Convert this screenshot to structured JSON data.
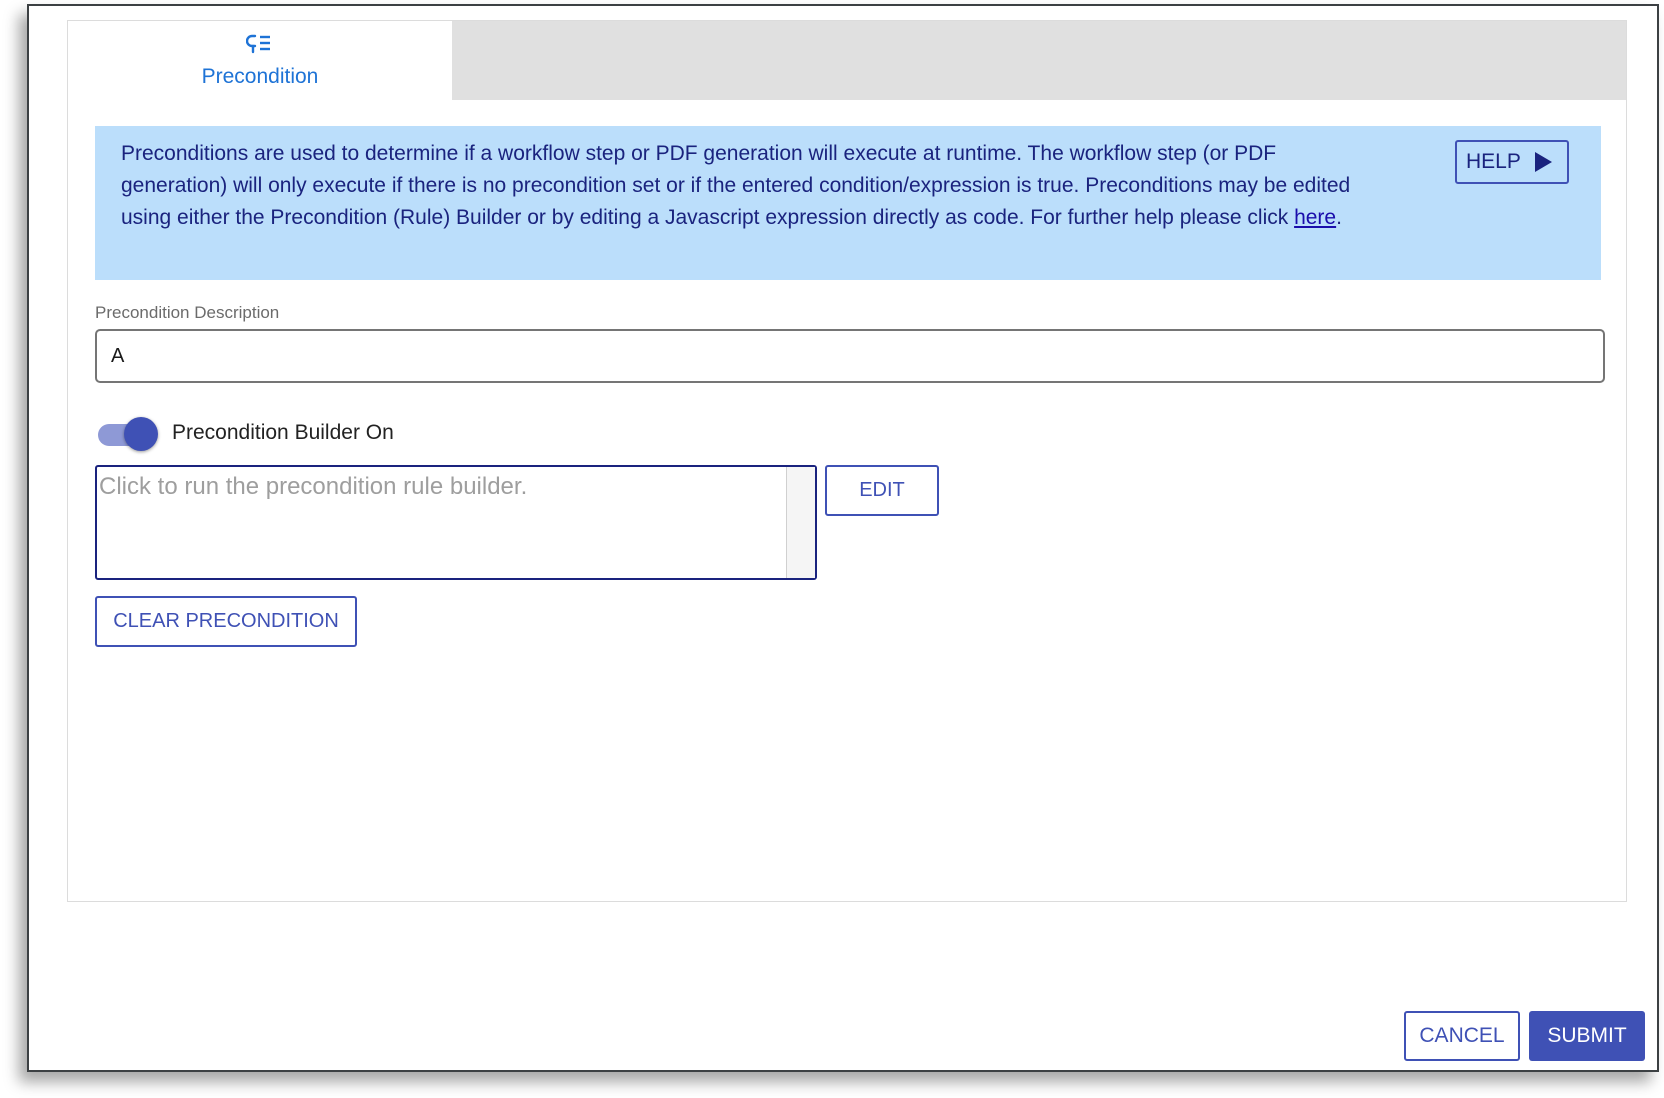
{
  "tabs": [
    {
      "label": "Precondition",
      "icon": "precondition-list-icon",
      "active": true
    }
  ],
  "info": {
    "text_before_link": "Preconditions are used to determine if a workflow step or PDF generation will execute at runtime. The workflow step (or PDF generation) will only execute if there is no precondition set or if the entered condition/expression is true. Preconditions may be edited using either the Precondition (Rule) Builder or by editing a Javascript expression directly as code. For further help please click ",
    "link_text": "here",
    "text_after_link": ".",
    "help_label": "HELP",
    "help_icon": "play-arrow-icon"
  },
  "description": {
    "label": "Precondition Description",
    "value": "A"
  },
  "builder": {
    "toggle_label": "Precondition Builder On",
    "toggle_on": true,
    "rule_placeholder": "Click to run the precondition rule builder.",
    "edit_label": "EDIT",
    "clear_label": "CLEAR PRECONDITION"
  },
  "footer": {
    "cancel_label": "CANCEL",
    "submit_label": "SUBMIT"
  },
  "colors": {
    "primary": "#3f51b5",
    "tab_active_text": "#1e73d6",
    "info_background": "#bbdefb",
    "info_text": "#1a237e"
  }
}
